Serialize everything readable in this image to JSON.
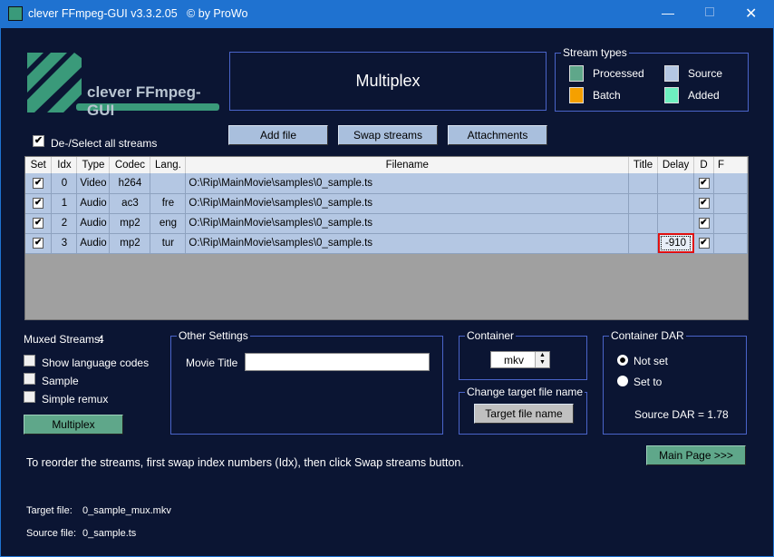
{
  "window": {
    "title": "clever FFmpeg-GUI v3.3.2.05   © by ProWo"
  },
  "logo": {
    "text": "clever FFmpeg-GUI"
  },
  "header": {
    "title": "Multiplex"
  },
  "stream_types": {
    "label": "Stream types",
    "items": [
      {
        "label": "Processed",
        "color": "#5fa78a"
      },
      {
        "label": "Source",
        "color": "#b4c7e3"
      },
      {
        "label": "Batch",
        "color": "#f5a000"
      },
      {
        "label": "Added",
        "color": "#6ef0c0"
      }
    ]
  },
  "toolbar": {
    "add_file": "Add file",
    "swap_streams": "Swap streams",
    "attachments": "Attachments"
  },
  "select_all": {
    "label": "De-/Select all streams",
    "checked": true
  },
  "table": {
    "columns": [
      "Set",
      "Idx",
      "Type",
      "Codec",
      "Lang.",
      "Filename",
      "Title",
      "Delay",
      "D",
      "F"
    ],
    "rows": [
      {
        "set": "✔",
        "idx": "0",
        "type": "Video",
        "codec": "h264",
        "lang": "",
        "filename": "O:\\Rip\\MainMovie\\samples\\0_sample.ts",
        "title": "",
        "delay": "",
        "d": "✔",
        "f": ""
      },
      {
        "set": "✔",
        "idx": "1",
        "type": "Audio",
        "codec": "ac3",
        "lang": "fre",
        "filename": "O:\\Rip\\MainMovie\\samples\\0_sample.ts",
        "title": "",
        "delay": "",
        "d": "✔",
        "f": ""
      },
      {
        "set": "✔",
        "idx": "2",
        "type": "Audio",
        "codec": "mp2",
        "lang": "eng",
        "filename": "O:\\Rip\\MainMovie\\samples\\0_sample.ts",
        "title": "",
        "delay": "",
        "d": "✔",
        "f": ""
      },
      {
        "set": "✔",
        "idx": "3",
        "type": "Audio",
        "codec": "mp2",
        "lang": "tur",
        "filename": "O:\\Rip\\MainMovie\\samples\\0_sample.ts",
        "title": "",
        "delay": "-910",
        "d": "✔",
        "f": ""
      }
    ]
  },
  "muxed": {
    "label": "Muxed Streams:",
    "count": "4"
  },
  "options": {
    "show_lang": "Show language codes",
    "sample": "Sample",
    "simple_remux": "Simple remux"
  },
  "multiplex_button": "Multiplex",
  "other_settings": {
    "label": "Other Settings",
    "movie_title_label": "Movie Title",
    "movie_title_value": ""
  },
  "container": {
    "label": "Container",
    "value": "mkv"
  },
  "change_target": {
    "label": "Change target file name",
    "button": "Target file name"
  },
  "dar": {
    "label": "Container DAR",
    "not_set": "Not set",
    "set_to": "Set to",
    "source_dar": "Source DAR = 1.78"
  },
  "main_page_button": "Main Page >>>",
  "hint": "To reorder the streams, first swap index numbers (Idx), then click Swap streams button.",
  "files": {
    "target_label": "Target file:",
    "target_value": "0_sample_mux.mkv",
    "source_label": "Source file:",
    "source_value": "0_sample.ts"
  }
}
